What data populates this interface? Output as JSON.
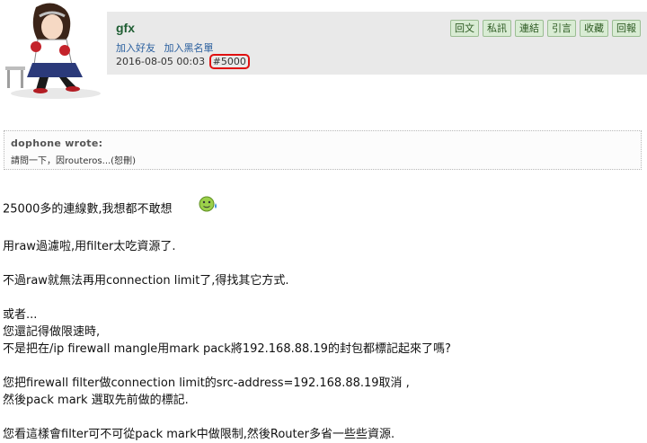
{
  "post": {
    "username": "gfx",
    "links": {
      "add_friend": "加入好友",
      "add_blacklist": "加入黑名單"
    },
    "timestamp": "2016-08-05 00:03",
    "post_id": "#5000"
  },
  "actions": [
    "回文",
    "私訊",
    "連結",
    "引言",
    "收藏",
    "回報"
  ],
  "quote": {
    "author": "dophone wrote:",
    "text": "請問一下，因routeros...(恕刪)"
  },
  "body": {
    "line1": "25000多的連線數,我想都不敢想",
    "line2": "用raw過濾啦,用filter太吃資源了.",
    "line3": "不過raw就無法再用connection limit了,得找其它方式.",
    "line4": "或者...",
    "line5": "您還記得做限速時,",
    "line6": "不是把在/ip firewall mangle用mark pack將192.168.88.19的封包都標記起來了嗎?",
    "line7": "您把firewall filter做connection limit的src-address=192.168.88.19取消 ,",
    "line8": "然後pack mark 選取先前做的標記.",
    "line9": "您看這樣會filter可不可從pack mark中做限制,然後Router多省一些些資源."
  },
  "colors": {
    "accent": "#1f5e33",
    "highlight": "#e01010",
    "button_bg": "#d9ecd4"
  },
  "icons": {
    "avatar": "anime-girl-avatar",
    "smiley": "sweat-smiley-icon"
  }
}
